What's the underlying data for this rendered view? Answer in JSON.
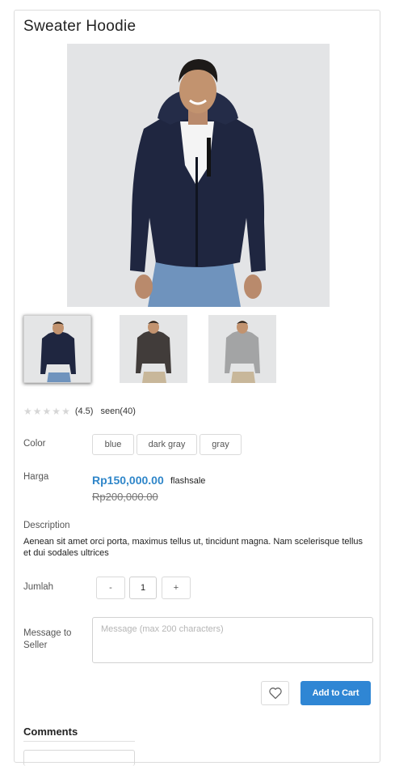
{
  "product": {
    "title": "Sweater Hoodie",
    "main_image": "navy-hoodie-model-photo"
  },
  "thumbnails": [
    {
      "name": "navy hoodie",
      "selected": true
    },
    {
      "name": "dark gray hoodie",
      "selected": false
    },
    {
      "name": "gray hoodie",
      "selected": false
    }
  ],
  "rating": {
    "stars": 0,
    "value_text": "(4.5)",
    "seen_text": "seen(40)"
  },
  "color": {
    "label": "Color",
    "options": [
      "blue",
      "dark gray",
      "gray"
    ]
  },
  "price": {
    "label": "Harga",
    "current": "Rp150,000.00",
    "badge": "flashsale",
    "original": "Rp200,000.00",
    "accent": "#2f86c9"
  },
  "description": {
    "label": "Description",
    "text": "Aenean sit amet orci porta, maximus tellus ut, tincidunt magna. Nam scelerisque tellus et dui sodales ultrices"
  },
  "quantity": {
    "label": "Jumlah",
    "minus": "-",
    "value": "1",
    "plus": "+"
  },
  "message": {
    "label": "Message to Seller",
    "placeholder": "Message (max 200 characters)"
  },
  "actions": {
    "wishlist_icon": "heart-icon",
    "add_to_cart": "Add to Cart",
    "button_color": "#2f86d4"
  },
  "comments": {
    "title": "Comments"
  }
}
